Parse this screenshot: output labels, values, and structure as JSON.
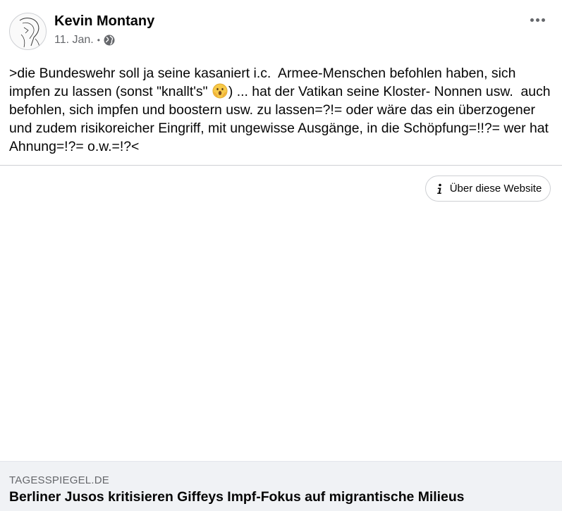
{
  "post": {
    "author": "Kevin Montany",
    "date": "11. Jan.",
    "separator": "•",
    "visibility_icon": "globe-icon",
    "more_icon": "more-horizontal-icon",
    "text_part1": ">die Bundeswehr soll ja seine kasaniert i.c.  Armee-Menschen befohlen haben, sich impfen zu lassen (sonst \"knallt's\" ",
    "emoji_icon": "shocked-face-emoji-icon",
    "text_part2": ") ... hat der Vatikan seine Kloster- Nonnen usw.  auch befohlen, sich impfen und boostern usw. zu lassen=?!= oder wäre das ein überzogener und zudem risikoreicher Eingriff, mit ungewisse Ausgänge, in die Schöpfung=!!?= wer hat Ahnung=!?= o.w.=!?<"
  },
  "link_preview": {
    "about_label": "Über diese Website",
    "about_icon": "info-icon",
    "domain": "TAGESSPIEGEL.DE",
    "title": "Berliner Jusos kritisieren Giffeys Impf-Fokus auf migrantische Milieus"
  },
  "colors": {
    "text": "#050505",
    "secondary_text": "#65676b",
    "divider": "#ced0d4",
    "footer_bg": "#f0f2f5"
  }
}
